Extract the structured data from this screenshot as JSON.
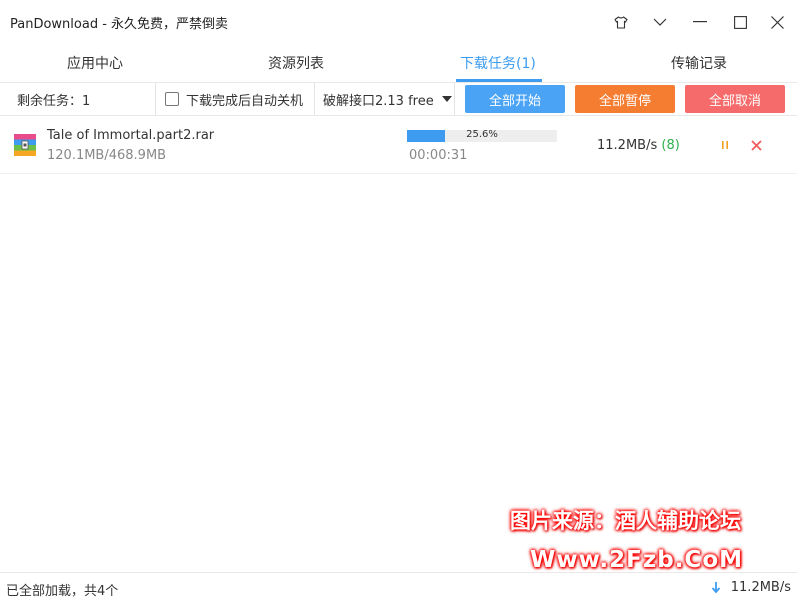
{
  "window": {
    "title": "PanDownload - 永久免费，严禁倒卖"
  },
  "tabs": [
    {
      "label": "应用中心"
    },
    {
      "label": "资源列表"
    },
    {
      "label": "下载任务(1)"
    },
    {
      "label": "传输记录"
    }
  ],
  "toolbar": {
    "remaining": "剩余任务：1",
    "auto_shutdown_label": "下载完成后自动关机",
    "interface_select": "破解接口2.13 free",
    "start_all": "全部开始",
    "pause_all": "全部暂停",
    "cancel_all": "全部取消"
  },
  "task": {
    "file_name": "Tale of Immortal.part2.rar",
    "size_progress": "120.1MB/468.9MB",
    "progress_fraction": 0.256,
    "progress_label": "25.6%",
    "elapsed": "00:00:31",
    "speed": "11.2MB/s",
    "connections": "(8)"
  },
  "status": {
    "text": "已全部加载，共4个",
    "speed": "11.2MB/s"
  },
  "watermark": {
    "line1": "图片来源：酒人辅助论坛",
    "line2": "Www.2Fzb.CoM"
  },
  "colors": {
    "accent": "#3d9cf0",
    "start_btn": "#4aa3f5",
    "pause_btn": "#f47d32",
    "cancel_btn": "#f56a6a",
    "pause_icon": "#f0a020",
    "cancel_icon": "#f25c5c",
    "conn_green": "#2fb04a"
  },
  "icons": {
    "skin": "shirt-icon",
    "menu": "chevron-down-icon",
    "minimize": "minimize-icon",
    "maximize": "maximize-icon",
    "close": "close-icon",
    "file": "rar-archive-icon",
    "pause": "pause-icon",
    "cancel": "cancel-icon",
    "download": "download-arrow-icon"
  }
}
